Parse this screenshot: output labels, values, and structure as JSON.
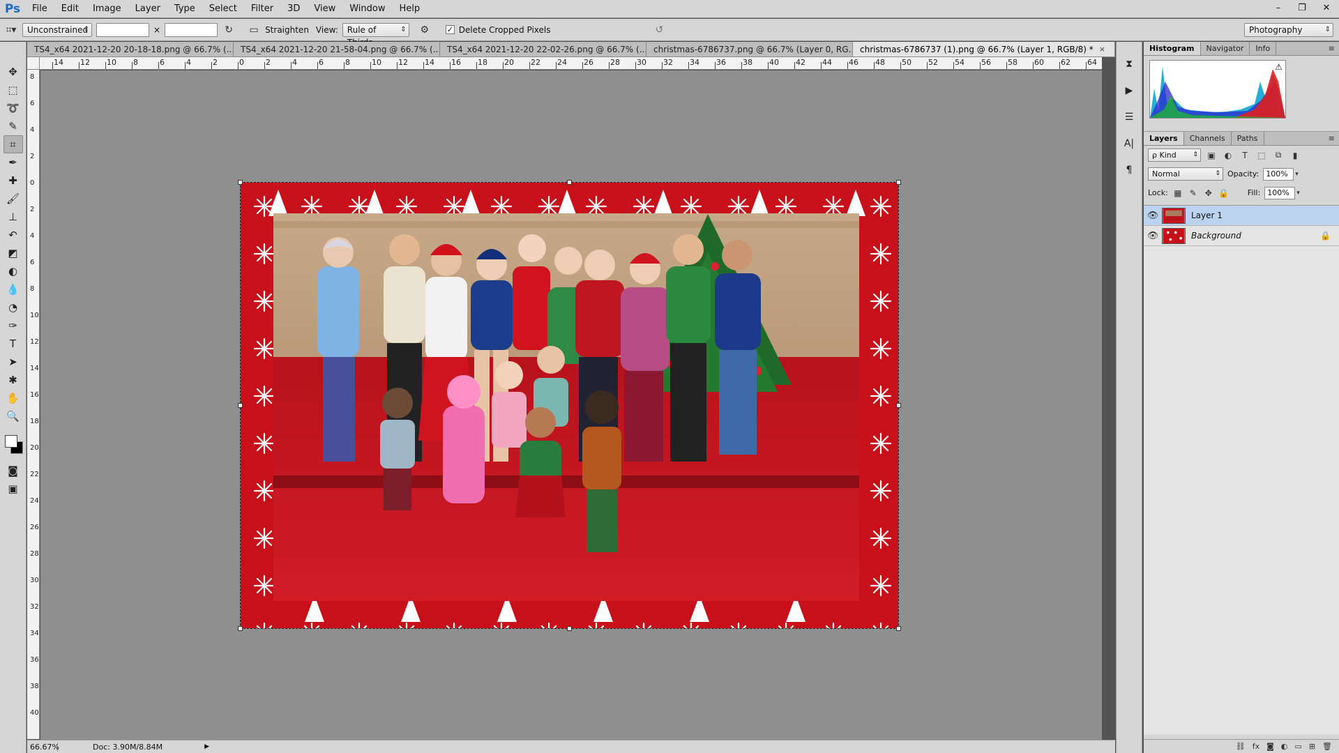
{
  "app": {
    "logo": "Ps",
    "menu": [
      "File",
      "Edit",
      "Image",
      "Layer",
      "Type",
      "Select",
      "Filter",
      "3D",
      "View",
      "Window",
      "Help"
    ],
    "window_controls": [
      "–",
      "❐",
      "✕"
    ]
  },
  "options": {
    "ratio": "Unconstrained",
    "width_value": "",
    "height_value": "",
    "times": "×",
    "straighten": "Straighten",
    "view_label": "View:",
    "view_value": "Rule of Thirds",
    "delete_cropped_label": "Delete Cropped Pixels",
    "delete_cropped_checked": "✓",
    "workspace": "Photography"
  },
  "tabs": [
    {
      "label": "TS4_x64 2021-12-20 20-18-18.png @ 66.7% (...",
      "close": "×"
    },
    {
      "label": "TS4_x64 2021-12-20 21-58-04.png @ 66.7% (...",
      "close": "×"
    },
    {
      "label": "TS4_x64 2021-12-20 22-02-26.png @ 66.7% (...",
      "close": "×"
    },
    {
      "label": "christmas-6786737.png @ 66.7% (Layer 0, RG...",
      "close": "×"
    },
    {
      "label": "christmas-6786737 (1).png @ 66.7% (Layer 1, RGB/8) *",
      "close": "×"
    }
  ],
  "ruler": {
    "top": [
      "14",
      "12",
      "10",
      "8",
      "6",
      "4",
      "2",
      "0",
      "2",
      "4",
      "6",
      "8",
      "10",
      "12",
      "14",
      "16",
      "18",
      "20",
      "22",
      "24",
      "26",
      "28",
      "30",
      "32",
      "34",
      "36",
      "38",
      "40",
      "42",
      "44",
      "46",
      "48",
      "50",
      "52",
      "54",
      "56",
      "58",
      "60",
      "62",
      "64"
    ],
    "left": [
      "8",
      "6",
      "4",
      "2",
      "0",
      "2",
      "4",
      "6",
      "8",
      "10",
      "12",
      "14",
      "16",
      "18",
      "20",
      "22",
      "24",
      "26",
      "28",
      "30",
      "32",
      "34",
      "36",
      "38",
      "40"
    ]
  },
  "status": {
    "zoom": "66.67%",
    "doc": "Doc: 3.90M/8.84M",
    "arrow": "▶"
  },
  "panels": {
    "top_tabs": [
      "Histogram",
      "Navigator",
      "Info"
    ],
    "histogram_warning": "⚠",
    "layers_tabs": [
      "Layers",
      "Channels",
      "Paths"
    ],
    "kind": "ρ Kind",
    "blend_mode": "Normal",
    "opacity_label": "Opacity:",
    "opacity_value": "100%",
    "lock_label": "Lock:",
    "fill_label": "Fill:",
    "fill_value": "100%",
    "layers": [
      {
        "name": "Layer 1",
        "selected": true,
        "locked": false
      },
      {
        "name": "Background",
        "selected": false,
        "locked": true
      }
    ]
  },
  "colors": {
    "accent": "#1c6cc6",
    "selected_layer": "#bcd3f0",
    "border_red": "#c8101a",
    "canvas_bg": "#8f8f8f"
  }
}
